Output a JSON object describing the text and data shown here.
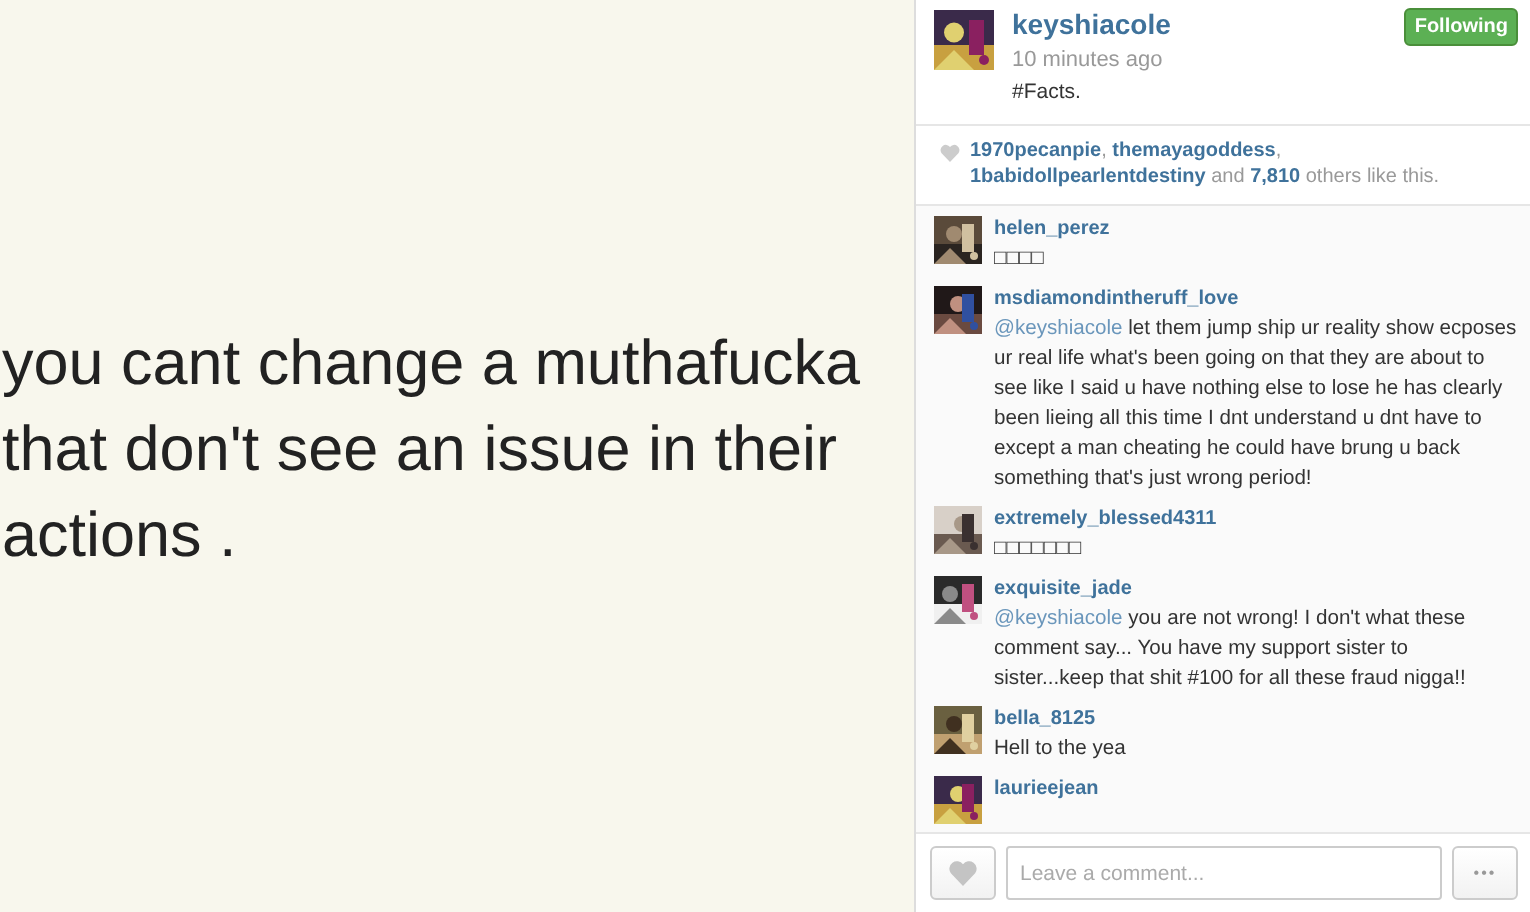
{
  "post": {
    "lines": [
      "you cant change a muthafucka",
      "that don't see an issue in their",
      "actions ."
    ]
  },
  "header": {
    "username": "keyshiacole",
    "time": "10 minutes ago",
    "caption": "#Facts.",
    "follow_button": {
      "label": "Following",
      "selected": true
    }
  },
  "likes": {
    "text": "**1970pecanpie**, **themayagoddess**, **1babidollpearlentdestiny** and **7,810** others like this."
  },
  "comments": [
    {
      "user": "helen_perez",
      "parts": [
        {
          "kind": "text",
          "text": "□□□□"
        }
      ]
    },
    {
      "user": "msdiamondintheruff_love",
      "parts": [
        {
          "kind": "mention",
          "text": "@keyshiacole"
        },
        {
          "kind": "text",
          "text": " let them jump ship ur reality show ecposes ur real life what's been going on that they are about to see like I said u have nothing else to lose he has clearly been lieing all this time I dnt understand u dnt have to except a man cheating he could have brung u back something that's just wrong period!"
        }
      ]
    },
    {
      "user": "extremely_blessed4311",
      "parts": [
        {
          "kind": "text",
          "text": "□□□□□□□"
        }
      ]
    },
    {
      "user": "exquisite_jade",
      "parts": [
        {
          "kind": "mention",
          "text": "@keyshiacole"
        },
        {
          "kind": "text",
          "text": " you are not wrong! I don't what these comment say... You have my support sister to sister...keep that shit #100 for all these fraud nigga!!"
        }
      ]
    },
    {
      "user": "bella_8125",
      "parts": [
        {
          "kind": "text",
          "text": "Hell to the yea"
        }
      ]
    },
    {
      "user": "laurieejean"
    }
  ],
  "comment_box": {
    "placeholder": "Leave a comment...",
    "more_label": "•••"
  }
}
